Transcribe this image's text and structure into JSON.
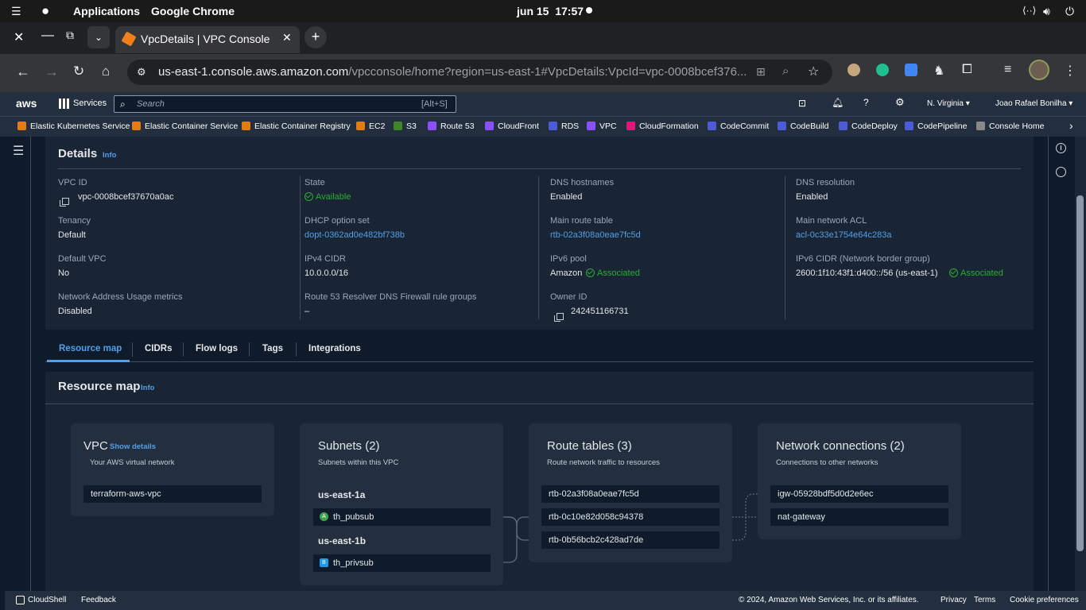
{
  "os": {
    "apps_label": "Applications",
    "active_app": "Google Chrome",
    "datetime": "jun 15  17:57"
  },
  "browser": {
    "tab_title": "VpcDetails | VPC Console",
    "url_host": "us-east-1.console.aws.amazon.com",
    "url_path": "/vpcconsole/home?region=us-east-1#VpcDetails:VpcId=vpc-0008bcef376..."
  },
  "aws_nav": {
    "logo": "aws",
    "services": "Services",
    "search_placeholder": "Search",
    "search_shortcut": "[Alt+S]",
    "region": "N. Virginia",
    "user": "Joao Rafael Bonilha"
  },
  "favorites": [
    {
      "label": "Elastic Kubernetes Service",
      "color": "#e57b13"
    },
    {
      "label": "Elastic Container Service",
      "color": "#e57b13"
    },
    {
      "label": "Elastic Container Registry",
      "color": "#e57b13"
    },
    {
      "label": "EC2",
      "color": "#e57b13"
    },
    {
      "label": "S3",
      "color": "#3f8624"
    },
    {
      "label": "Route 53",
      "color": "#8c4fff"
    },
    {
      "label": "CloudFront",
      "color": "#8c4fff"
    },
    {
      "label": "RDS",
      "color": "#4d5bd6"
    },
    {
      "label": "VPC",
      "color": "#8c4fff"
    },
    {
      "label": "CloudFormation",
      "color": "#e7157b"
    },
    {
      "label": "CodeCommit",
      "color": "#4d5bd6"
    },
    {
      "label": "CodeBuild",
      "color": "#4d5bd6"
    },
    {
      "label": "CodeDeploy",
      "color": "#4d5bd6"
    },
    {
      "label": "CodePipeline",
      "color": "#4d5bd6"
    },
    {
      "label": "Console Home",
      "color": "#888888"
    }
  ],
  "details": {
    "title": "Details",
    "info": "Info",
    "vpc_id_label": "VPC ID",
    "vpc_id": "vpc-0008bcef37670a0ac",
    "state_label": "State",
    "state": "Available",
    "dns_hostnames_label": "DNS hostnames",
    "dns_hostnames": "Enabled",
    "dns_resolution_label": "DNS resolution",
    "dns_resolution": "Enabled",
    "tenancy_label": "Tenancy",
    "tenancy": "Default",
    "dhcp_label": "DHCP option set",
    "dhcp": "dopt-0362ad0e482bf738b",
    "main_rt_label": "Main route table",
    "main_rt": "rtb-02a3f08a0eae7fc5d",
    "main_acl_label": "Main network ACL",
    "main_acl": "acl-0c33e1754e64c283a",
    "default_vpc_label": "Default VPC",
    "default_vpc": "No",
    "ipv4_label": "IPv4 CIDR",
    "ipv4": "10.0.0.0/16",
    "ipv6_pool_label": "IPv6 pool",
    "ipv6_pool": "Amazon",
    "ipv6_pool_status": "Associated",
    "ipv6_cidr_label": "IPv6 CIDR (Network border group)",
    "ipv6_cidr": "2600:1f10:43f1:d400::/56 (us-east-1)",
    "ipv6_cidr_status": "Associated",
    "nau_label": "Network Address Usage metrics",
    "nau": "Disabled",
    "r53_label": "Route 53 Resolver DNS Firewall rule groups",
    "r53": "–",
    "owner_label": "Owner ID",
    "owner": "242451166731"
  },
  "tabs": [
    "Resource map",
    "CIDRs",
    "Flow logs",
    "Tags",
    "Integrations"
  ],
  "resource_map": {
    "title": "Resource map",
    "info": "Info",
    "vpc": {
      "title": "VPC",
      "show_details": "Show details",
      "subtitle": "Your AWS virtual network",
      "name": "terraform-aws-vpc"
    },
    "subnets": {
      "title": "Subnets (2)",
      "subtitle": "Subnets within this VPC",
      "az1": "us-east-1a",
      "sub1": "th_pubsub",
      "sub1_badge": "A",
      "az2": "us-east-1b",
      "sub2": "th_privsub",
      "sub2_badge": "B"
    },
    "route_tables": {
      "title": "Route tables (3)",
      "subtitle": "Route network traffic to resources",
      "items": [
        "rtb-02a3f08a0eae7fc5d",
        "rtb-0c10e82d058c94378",
        "rtb-0b56bcb2c428ad7de"
      ]
    },
    "connections": {
      "title": "Network connections (2)",
      "subtitle": "Connections to other networks",
      "items": [
        "igw-05928bdf5d0d2e6ec",
        "nat-gateway"
      ]
    }
  },
  "footer": {
    "cloudshell": "CloudShell",
    "feedback": "Feedback",
    "copyright": "© 2024, Amazon Web Services, Inc. or its affiliates.",
    "privacy": "Privacy",
    "terms": "Terms",
    "cookies": "Cookie preferences"
  }
}
